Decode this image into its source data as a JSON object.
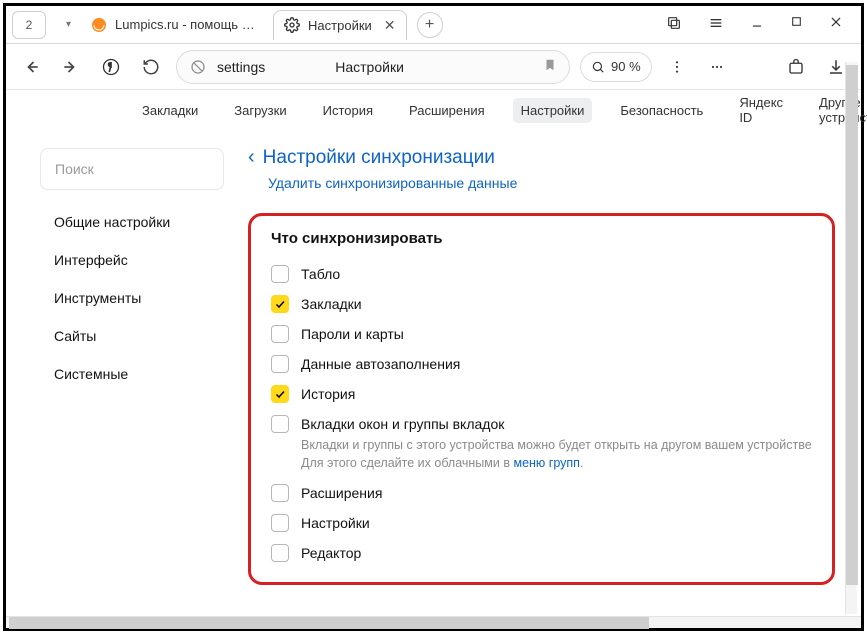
{
  "tabs": {
    "group_badge": "2",
    "inactive": {
      "title": "Lumpics.ru - помощь с ком"
    },
    "active": {
      "title": "Настройки"
    }
  },
  "toolbar": {
    "url": "settings",
    "page_title": "Настройки",
    "zoom": "90 %"
  },
  "subtabs": [
    "Закладки",
    "Загрузки",
    "История",
    "Расширения",
    "Настройки",
    "Безопасность",
    "Яндекс ID",
    "Другие устройства"
  ],
  "subtabs_active_index": 4,
  "sidebar": {
    "search_placeholder": "Поиск",
    "items": [
      "Общие настройки",
      "Интерфейс",
      "Инструменты",
      "Сайты",
      "Системные"
    ]
  },
  "main": {
    "breadcrumb": "Настройки синхронизации",
    "delete_link": "Удалить синхронизированные данные",
    "section_title": "Что синхронизировать",
    "options": [
      {
        "label": "Табло",
        "checked": false
      },
      {
        "label": "Закладки",
        "checked": true
      },
      {
        "label": "Пароли и карты",
        "checked": false
      },
      {
        "label": "Данные автозаполнения",
        "checked": false
      },
      {
        "label": "История",
        "checked": true
      },
      {
        "label": "Вкладки окон и группы вкладок",
        "checked": false,
        "desc_prefix": "Вкладки и группы с этого устройства можно будет открыть на другом вашем устройстве Для этого сделайте их облачными в ",
        "desc_link": "меню групп",
        "desc_suffix": "."
      },
      {
        "label": "Расширения",
        "checked": false
      },
      {
        "label": "Настройки",
        "checked": false
      },
      {
        "label": "Редактор",
        "checked": false
      }
    ]
  }
}
